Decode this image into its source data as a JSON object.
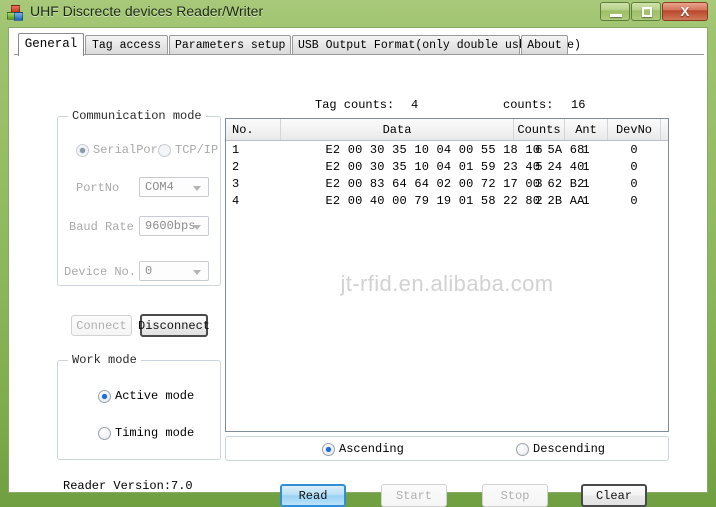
{
  "window": {
    "title": "UHF Discrecte devices Reader/Writer",
    "icon": "app-blocks-icon",
    "controls": {
      "minimize": "–",
      "maximize": "□",
      "close": "X"
    }
  },
  "tabs": [
    {
      "label": "General",
      "active": true
    },
    {
      "label": "Tag access",
      "active": false
    },
    {
      "label": "Parameters setup",
      "active": false
    },
    {
      "label": "USB Output Format(only double usb device)",
      "active": false
    },
    {
      "label": "About",
      "active": false
    }
  ],
  "communication_mode": {
    "legend": "Communication mode",
    "modes": [
      {
        "label": "SerialPort",
        "selected": true
      },
      {
        "label": "TCP/IP",
        "selected": false
      }
    ],
    "fields": [
      {
        "label": "PortNo",
        "value": "COM4"
      },
      {
        "label": "Baud Rate",
        "value": "9600bps"
      },
      {
        "label": "Device No.",
        "value": "0"
      }
    ]
  },
  "connection_buttons": {
    "connect": "Connect",
    "disconnect": "Disconnect"
  },
  "work_mode": {
    "legend": "Work mode",
    "options": [
      {
        "label": "Active mode",
        "selected": true
      },
      {
        "label": "Timing mode",
        "selected": false
      }
    ]
  },
  "reader_version": "Reader Version:7.0",
  "counts": {
    "tag_counts_label": "Tag counts:",
    "tag_counts_value": "4",
    "counts_label": "counts:",
    "counts_value": "16"
  },
  "table": {
    "headers": [
      "No.",
      "Data",
      "Counts",
      "Ant",
      "DevNo",
      ""
    ],
    "rows": [
      {
        "no": "1",
        "data": "E2 00 30 35 10 04 00 55 18 10 5A 68",
        "counts": "6",
        "ant": "1",
        "devno": "0"
      },
      {
        "no": "2",
        "data": "E2 00 30 35 10 04 01 59 23 40 24 40",
        "counts": "5",
        "ant": "1",
        "devno": "0"
      },
      {
        "no": "3",
        "data": "E2 00 83 64 64 02 00 72 17 00 62 B2",
        "counts": "3",
        "ant": "1",
        "devno": "0"
      },
      {
        "no": "4",
        "data": "E2 00 40 00 79 19 01 58 22 80 2B AA",
        "counts": "2",
        "ant": "1",
        "devno": "0"
      }
    ]
  },
  "watermark": "jt-rfid.en.alibaba.com",
  "sort": {
    "options": [
      {
        "label": "Ascending",
        "selected": true
      },
      {
        "label": "Descending",
        "selected": false
      }
    ]
  },
  "action_buttons": {
    "read": "Read",
    "start": "Start",
    "stop": "Stop",
    "clear": "Clear"
  },
  "colors": {
    "window_frame_green": "#8fbb5f",
    "close_red": "#b9462c",
    "default_button_blue": "#2f8ed6",
    "radio_selected_blue": "#1e6fd9",
    "watermark_gray": "#d2d2d2"
  }
}
